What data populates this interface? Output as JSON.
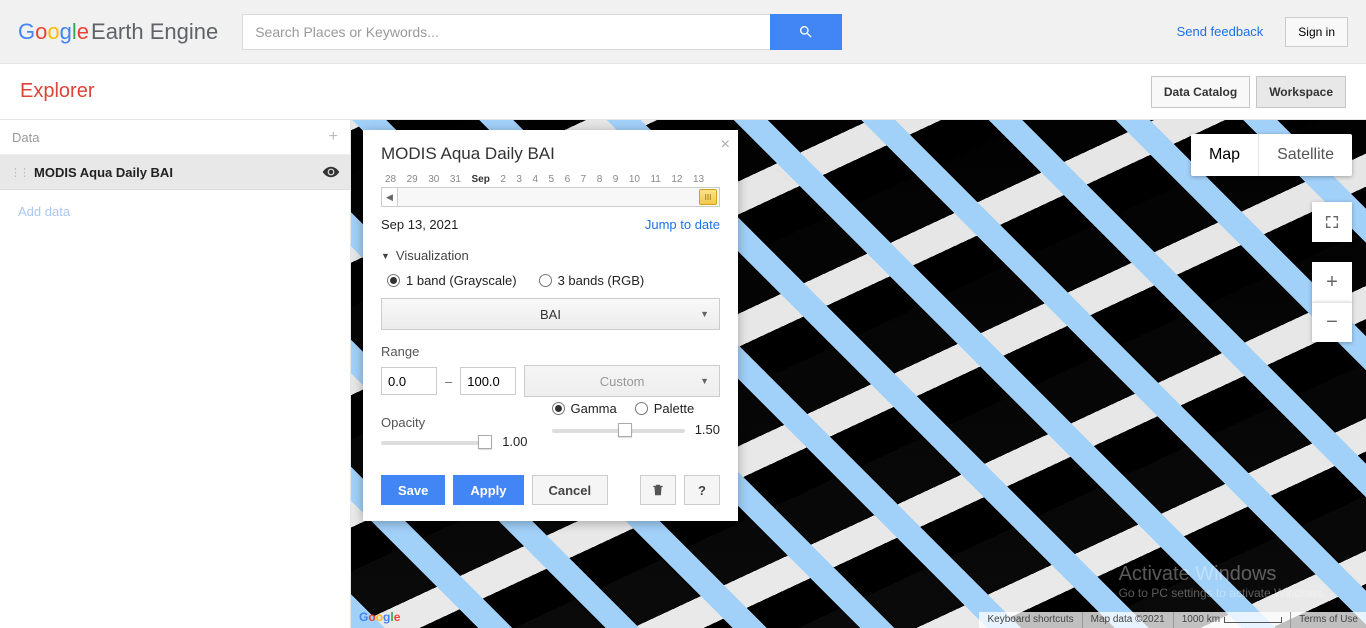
{
  "header": {
    "product": "Earth Engine",
    "search_placeholder": "Search Places or Keywords...",
    "feedback": "Send feedback",
    "signin": "Sign in"
  },
  "toolbar": {
    "title": "Explorer",
    "data_catalog": "Data Catalog",
    "workspace": "Workspace"
  },
  "sidebar": {
    "data_label": "Data",
    "layer": "MODIS Aqua Daily BAI",
    "add_data": "Add data"
  },
  "popup": {
    "title": "MODIS Aqua Daily BAI",
    "timeline": {
      "ticks": [
        "28",
        "29",
        "30",
        "31",
        "Sep",
        "2",
        "3",
        "4",
        "5",
        "6",
        "7",
        "8",
        "9",
        "10",
        "11",
        "12",
        "13"
      ],
      "month_index": 4
    },
    "date": "Sep 13, 2021",
    "jump": "Jump to date",
    "visualization": "Visualization",
    "band_gray": "1 band (Grayscale)",
    "band_rgb": "3 bands (RGB)",
    "band_selected": "BAI",
    "range_label": "Range",
    "range_min": "0.0",
    "range_max": "100.0",
    "range_mode": "Custom",
    "opacity_label": "Opacity",
    "opacity_value": "1.00",
    "gamma_label": "Gamma",
    "palette_label": "Palette",
    "gamma_value": "1.50",
    "save": "Save",
    "apply": "Apply",
    "cancel": "Cancel",
    "help": "?"
  },
  "map": {
    "map_tab": "Map",
    "satellite_tab": "Satellite",
    "footer": {
      "shortcuts": "Keyboard shortcuts",
      "data": "Map data ©2021",
      "scale": "1000 km",
      "terms": "Terms of Use"
    },
    "watermark_title": "Activate Windows",
    "watermark_sub": "Go to PC settings to activate Windows."
  }
}
